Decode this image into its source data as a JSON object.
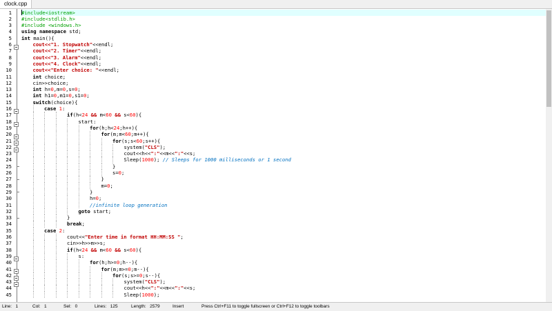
{
  "tab": {
    "title": "clock.cpp"
  },
  "editor": {
    "current_line": 1,
    "lines": [
      {
        "n": "1",
        "depth": 0,
        "segs": [
          [
            "#include<iostream>",
            "pp"
          ]
        ]
      },
      {
        "n": "2",
        "depth": 0,
        "segs": [
          [
            "#include<stdlib.h>",
            "pp"
          ]
        ]
      },
      {
        "n": "3",
        "depth": 0,
        "segs": [
          [
            "#include <windows.h>",
            "pp"
          ]
        ]
      },
      {
        "n": "4",
        "depth": 0,
        "segs": [
          [
            "using namespace",
            "kw"
          ],
          [
            " std;",
            ""
          ]
        ]
      },
      {
        "n": "5",
        "depth": 0,
        "fold": "open",
        "segs": [
          [
            "int",
            "kw"
          ],
          [
            " main(){",
            ""
          ]
        ]
      },
      {
        "n": "6",
        "depth": 1,
        "segs": [
          [
            "cout<<",
            "op"
          ],
          [
            "\"1. Stopwatch\"",
            "st"
          ],
          [
            "<<endl;",
            ""
          ]
        ]
      },
      {
        "n": "7",
        "depth": 1,
        "segs": [
          [
            "cout<<",
            "op"
          ],
          [
            "\"2. Timer\"",
            "st"
          ],
          [
            "<<endl;",
            ""
          ]
        ]
      },
      {
        "n": "8",
        "depth": 1,
        "segs": [
          [
            "cout<<",
            "op"
          ],
          [
            "\"3. Alarm\"",
            "st"
          ],
          [
            "<<endl;",
            ""
          ]
        ]
      },
      {
        "n": "9",
        "depth": 1,
        "segs": [
          [
            "cout<<",
            "op"
          ],
          [
            "\"4. Clock\"",
            "st"
          ],
          [
            "<<endl;",
            ""
          ]
        ]
      },
      {
        "n": "10",
        "depth": 1,
        "segs": [
          [
            "cout<<",
            "op"
          ],
          [
            "\"Enter choice: \"",
            "st"
          ],
          [
            "<<endl;",
            ""
          ]
        ]
      },
      {
        "n": "11",
        "depth": 1,
        "segs": [
          [
            "int",
            "kw"
          ],
          [
            " choice;",
            ""
          ]
        ]
      },
      {
        "n": "12",
        "depth": 1,
        "segs": [
          [
            "cin>>choice;",
            ""
          ]
        ]
      },
      {
        "n": "13",
        "depth": 1,
        "segs": [
          [
            "int",
            "kw"
          ],
          [
            " h=",
            ""
          ],
          [
            "0",
            "num"
          ],
          [
            ",m=",
            ""
          ],
          [
            "0",
            "num"
          ],
          [
            ",s=",
            ""
          ],
          [
            "0",
            "num"
          ],
          [
            ";",
            ""
          ]
        ]
      },
      {
        "n": "14",
        "depth": 1,
        "segs": [
          [
            "int",
            "kw"
          ],
          [
            " h1=",
            ""
          ],
          [
            "0",
            "num"
          ],
          [
            ",m1=",
            ""
          ],
          [
            "0",
            "num"
          ],
          [
            ",s1=",
            ""
          ],
          [
            "0",
            "num"
          ],
          [
            ";",
            ""
          ]
        ]
      },
      {
        "n": "15",
        "depth": 1,
        "fold": "open",
        "segs": [
          [
            "switch",
            "kw"
          ],
          [
            "(choice){",
            ""
          ]
        ]
      },
      {
        "n": "16",
        "depth": 2,
        "segs": [
          [
            "case",
            "kw"
          ],
          [
            " ",
            ""
          ],
          [
            "1",
            "num"
          ],
          [
            ":",
            ""
          ]
        ]
      },
      {
        "n": "17",
        "depth": 4,
        "fold": "open",
        "segs": [
          [
            "if",
            "kw"
          ],
          [
            "(h<",
            ""
          ],
          [
            "24",
            "num"
          ],
          [
            " && ",
            "op"
          ],
          [
            "m<",
            ""
          ],
          [
            "60",
            "num"
          ],
          [
            " && ",
            "op"
          ],
          [
            "s<",
            ""
          ],
          [
            "60",
            "num"
          ],
          [
            "){",
            ""
          ]
        ]
      },
      {
        "n": "18",
        "depth": 5,
        "segs": [
          [
            "start:",
            ""
          ]
        ]
      },
      {
        "n": "19",
        "depth": 6,
        "fold": "open",
        "segs": [
          [
            "for",
            "kw"
          ],
          [
            "(h;h<",
            ""
          ],
          [
            "24",
            "num"
          ],
          [
            ";h++){",
            ""
          ]
        ]
      },
      {
        "n": "20",
        "depth": 7,
        "fold": "open",
        "segs": [
          [
            "for",
            "kw"
          ],
          [
            "(m;m<",
            ""
          ],
          [
            "60",
            "num"
          ],
          [
            ";m++){",
            ""
          ]
        ]
      },
      {
        "n": "21",
        "depth": 8,
        "fold": "open",
        "segs": [
          [
            "for",
            "kw"
          ],
          [
            "(s;s<",
            ""
          ],
          [
            "60",
            "num"
          ],
          [
            ";s++){",
            ""
          ]
        ]
      },
      {
        "n": "22",
        "depth": 9,
        "segs": [
          [
            "system(",
            ""
          ],
          [
            "\"CLS\"",
            "st"
          ],
          [
            ");",
            ""
          ]
        ]
      },
      {
        "n": "23",
        "depth": 9,
        "segs": [
          [
            "cout<<h<<",
            ""
          ],
          [
            "\":\"",
            "st"
          ],
          [
            "<<m<<",
            ""
          ],
          [
            "\":\"",
            "st"
          ],
          [
            "<<s;",
            ""
          ]
        ]
      },
      {
        "n": "24",
        "depth": 9,
        "segs": [
          [
            "Sleep(",
            ""
          ],
          [
            "1000",
            "num"
          ],
          [
            "); ",
            ""
          ],
          [
            "// Sleeps for 1000 milliseconds or 1 second",
            "cm"
          ]
        ]
      },
      {
        "n": "25",
        "depth": 8,
        "fold": "end",
        "segs": [
          [
            "}",
            ""
          ]
        ]
      },
      {
        "n": "26",
        "depth": 8,
        "segs": [
          [
            "s=",
            ""
          ],
          [
            "0",
            "num"
          ],
          [
            ";",
            ""
          ]
        ]
      },
      {
        "n": "27",
        "depth": 7,
        "fold": "end",
        "segs": [
          [
            "}",
            ""
          ]
        ]
      },
      {
        "n": "28",
        "depth": 7,
        "segs": [
          [
            "m=",
            ""
          ],
          [
            "0",
            "num"
          ],
          [
            ";",
            ""
          ]
        ]
      },
      {
        "n": "29",
        "depth": 6,
        "fold": "end",
        "segs": [
          [
            "}",
            ""
          ]
        ]
      },
      {
        "n": "30",
        "depth": 6,
        "segs": [
          [
            "h=",
            ""
          ],
          [
            "0",
            "num"
          ],
          [
            ";",
            ""
          ]
        ]
      },
      {
        "n": "31",
        "depth": 6,
        "segs": [
          [
            "//infinite loop generation",
            "cm"
          ]
        ]
      },
      {
        "n": "32",
        "depth": 5,
        "segs": [
          [
            "goto",
            "kw"
          ],
          [
            " start;",
            ""
          ]
        ]
      },
      {
        "n": "33",
        "depth": 4,
        "fold": "end",
        "segs": [
          [
            "}",
            ""
          ]
        ]
      },
      {
        "n": "34",
        "depth": 4,
        "segs": [
          [
            "break",
            "kw"
          ],
          [
            ";",
            ""
          ]
        ]
      },
      {
        "n": "35",
        "depth": 2,
        "segs": [
          [
            "case",
            "kw"
          ],
          [
            " ",
            ""
          ],
          [
            "2",
            "num"
          ],
          [
            ":",
            ""
          ]
        ]
      },
      {
        "n": "36",
        "depth": 4,
        "segs": [
          [
            "cout<<",
            ""
          ],
          [
            "\"Enter time in format HH:MM:SS \"",
            "st"
          ],
          [
            ";",
            ""
          ]
        ]
      },
      {
        "n": "37",
        "depth": 4,
        "segs": [
          [
            "cin>>h>>m>>s;",
            ""
          ]
        ]
      },
      {
        "n": "38",
        "depth": 4,
        "fold": "open",
        "segs": [
          [
            "if",
            "kw"
          ],
          [
            "(h<",
            ""
          ],
          [
            "24",
            "num"
          ],
          [
            " && ",
            "op"
          ],
          [
            "m<",
            ""
          ],
          [
            "60",
            "num"
          ],
          [
            " && ",
            "op"
          ],
          [
            "s<",
            ""
          ],
          [
            "60",
            "num"
          ],
          [
            "){",
            ""
          ]
        ]
      },
      {
        "n": "39",
        "depth": 5,
        "segs": [
          [
            "s:",
            ""
          ]
        ]
      },
      {
        "n": "40",
        "depth": 6,
        "fold": "open",
        "segs": [
          [
            "for",
            "kw"
          ],
          [
            "(h;h>=",
            ""
          ],
          [
            "0",
            "num"
          ],
          [
            ";h--){",
            ""
          ]
        ]
      },
      {
        "n": "41",
        "depth": 7,
        "fold": "open",
        "segs": [
          [
            "for",
            "kw"
          ],
          [
            "(m;m>=",
            ""
          ],
          [
            "0",
            "num"
          ],
          [
            ";m--){",
            ""
          ]
        ]
      },
      {
        "n": "42",
        "depth": 8,
        "fold": "open",
        "segs": [
          [
            "for",
            "kw"
          ],
          [
            "(s;s>=",
            ""
          ],
          [
            "0",
            "num"
          ],
          [
            ";s--){",
            ""
          ]
        ]
      },
      {
        "n": "43",
        "depth": 9,
        "segs": [
          [
            "system(",
            ""
          ],
          [
            "\"CLS\"",
            "st"
          ],
          [
            ");",
            ""
          ]
        ]
      },
      {
        "n": "44",
        "depth": 9,
        "segs": [
          [
            "cout<<h<<",
            ""
          ],
          [
            "\":\"",
            "st"
          ],
          [
            "<<m<<",
            ""
          ],
          [
            "\":\"",
            "st"
          ],
          [
            "<<s;",
            ""
          ]
        ]
      },
      {
        "n": "45",
        "depth": 9,
        "segs": [
          [
            "Sleep(",
            ""
          ],
          [
            "1000",
            "num"
          ],
          [
            ");",
            ""
          ]
        ]
      }
    ]
  },
  "status": {
    "line": "Line:   1",
    "col": "Col:   1",
    "sel": "Sel:   0",
    "lines": "Lines:   125",
    "length": "Length:   2579",
    "mode": "Insert",
    "hint": "Press Ctrl+F11 to toggle fullscreen or Ctrl+F12 to toggle toolbars"
  },
  "icons": {
    "fold_open": "minus-box-icon",
    "fold_end": "fold-end-icon"
  }
}
